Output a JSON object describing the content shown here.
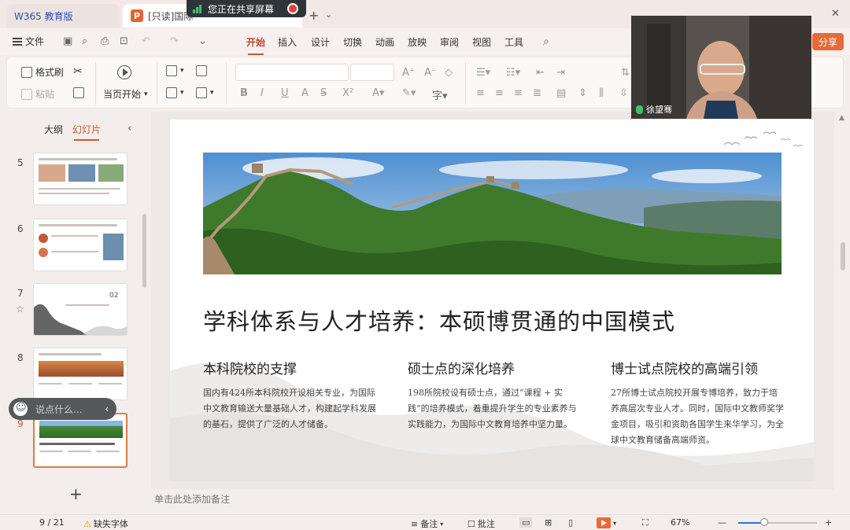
{
  "tabs": {
    "home_label": "W365 教育版",
    "doc_label": "[只读]国际",
    "share_banner": "您正在共享屏幕"
  },
  "menu": {
    "file": "文件",
    "items": [
      "开始",
      "插入",
      "设计",
      "切换",
      "动画",
      "放映",
      "审阅",
      "视图",
      "工具"
    ],
    "active": "开始",
    "share": "分享"
  },
  "ribbon": {
    "format_painter": "格式刷",
    "paste": "粘贴",
    "play_from_current": "当页开始"
  },
  "left_panel": {
    "tab_outline": "大纲",
    "tab_slides": "幻灯片",
    "slide_numbers": [
      "5",
      "6",
      "7",
      "8",
      "9"
    ],
    "selected": "9",
    "thumb7_num": "02",
    "comment_placeholder": "说点什么..."
  },
  "slide": {
    "title": "学科体系与人才培养：本硕博贯通的中国模式",
    "columns": [
      {
        "heading": "本科院校的支撑",
        "text": "国内有424所本科院校开设相关专业，为国际中文教育输送大量基础人才，构建起学科发展的基石，提供了广泛的人才储备。"
      },
      {
        "heading": "硕士点的深化培养",
        "text": "198所院校设有硕士点，通过“课程 + 实践”的培养模式，着重提升学生的专业素养与实践能力，为国际中文教育培养中坚力量。"
      },
      {
        "heading": "博士试点院校的高端引领",
        "text": "27所博士试点院校开展专博培养，致力于培养高层次专业人才。同时，国际中文教师奖学金项目，吸引和资助各国学生来华学习，为全球中文教育储备高端师资。"
      }
    ]
  },
  "notes_placeholder": "单击此处添加备注",
  "status": {
    "page": "9 / 21",
    "missing_font": "缺失字体",
    "notes": "备注",
    "comments": "批注",
    "zoom": "67%"
  },
  "video": {
    "name": "徐望骞"
  },
  "colors": {
    "accent": "#d2582f",
    "share": "#e8693b"
  }
}
